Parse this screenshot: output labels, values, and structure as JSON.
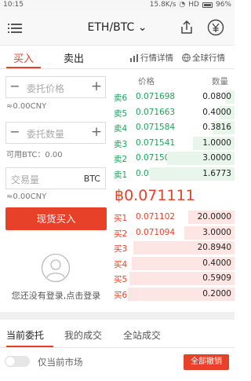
{
  "status_bar": {
    "time": "10:15",
    "speed": "15.8K/s",
    "network": "HD",
    "battery": "96%"
  },
  "header": {
    "title": "ETH/BTC",
    "dropdown_glyph": "⌄"
  },
  "trade_tabs": {
    "buy": "买入",
    "sell": "卖出"
  },
  "links": {
    "market_detail": "行情详情",
    "global_market": "全球行情"
  },
  "form": {
    "price_placeholder": "委托价格",
    "price_cny": "≈0.00CNY",
    "quantity_placeholder": "委托数量",
    "available": "可用BTC：0.00",
    "amount_placeholder": "交易量",
    "amount_unit": "BTC",
    "amount_cny": "≈0.00CNY",
    "submit_label": "现货买入"
  },
  "login_hint": "您还没有登录,点击登录",
  "order_book": {
    "price_header": "价格",
    "qty_header": "数量",
    "asks": [
      {
        "label": "卖6",
        "price": "0.071698",
        "qty": "0.0800",
        "depth": 0.08
      },
      {
        "label": "卖5",
        "price": "0.071663",
        "qty": "0.4000",
        "depth": 0.12
      },
      {
        "label": "卖4",
        "price": "0.071584",
        "qty": "0.3816",
        "depth": 0.18
      },
      {
        "label": "卖3",
        "price": "0.071541",
        "qty": "1.0000",
        "depth": 0.34
      },
      {
        "label": "卖2",
        "price": "0.071504",
        "qty": "3.0000",
        "depth": 0.55
      },
      {
        "label": "卖1",
        "price": "0.071494",
        "qty": "1.6773",
        "depth": 0.69
      }
    ],
    "last_price": "฿0.071111",
    "bids": [
      {
        "label": "买1",
        "price": "0.071102",
        "qty": "20.0000",
        "depth": 0.38
      },
      {
        "label": "买2",
        "price": "0.071094",
        "qty": "3.0000",
        "depth": 0.41
      },
      {
        "label": "买3",
        "price": "0.071089",
        "qty": "20.8940",
        "depth": 0.83
      },
      {
        "label": "买4",
        "price": "0.070940",
        "qty": "0.4000",
        "depth": 0.84
      },
      {
        "label": "买5",
        "price": "0.070900",
        "qty": "0.5909",
        "depth": 0.86
      },
      {
        "label": "买6",
        "price": "0.070829",
        "qty": "0.2000",
        "depth": 0.87
      }
    ]
  },
  "bottom_tabs": {
    "current": "当前委托",
    "my_trades": "我的成交",
    "all_trades": "全站成交"
  },
  "filter_label": "仅当前市场",
  "cancel_all_label": "全部撤销",
  "colors": {
    "accent": "#e8412a",
    "ask": "#22a05a",
    "bid": "#e8412a"
  }
}
